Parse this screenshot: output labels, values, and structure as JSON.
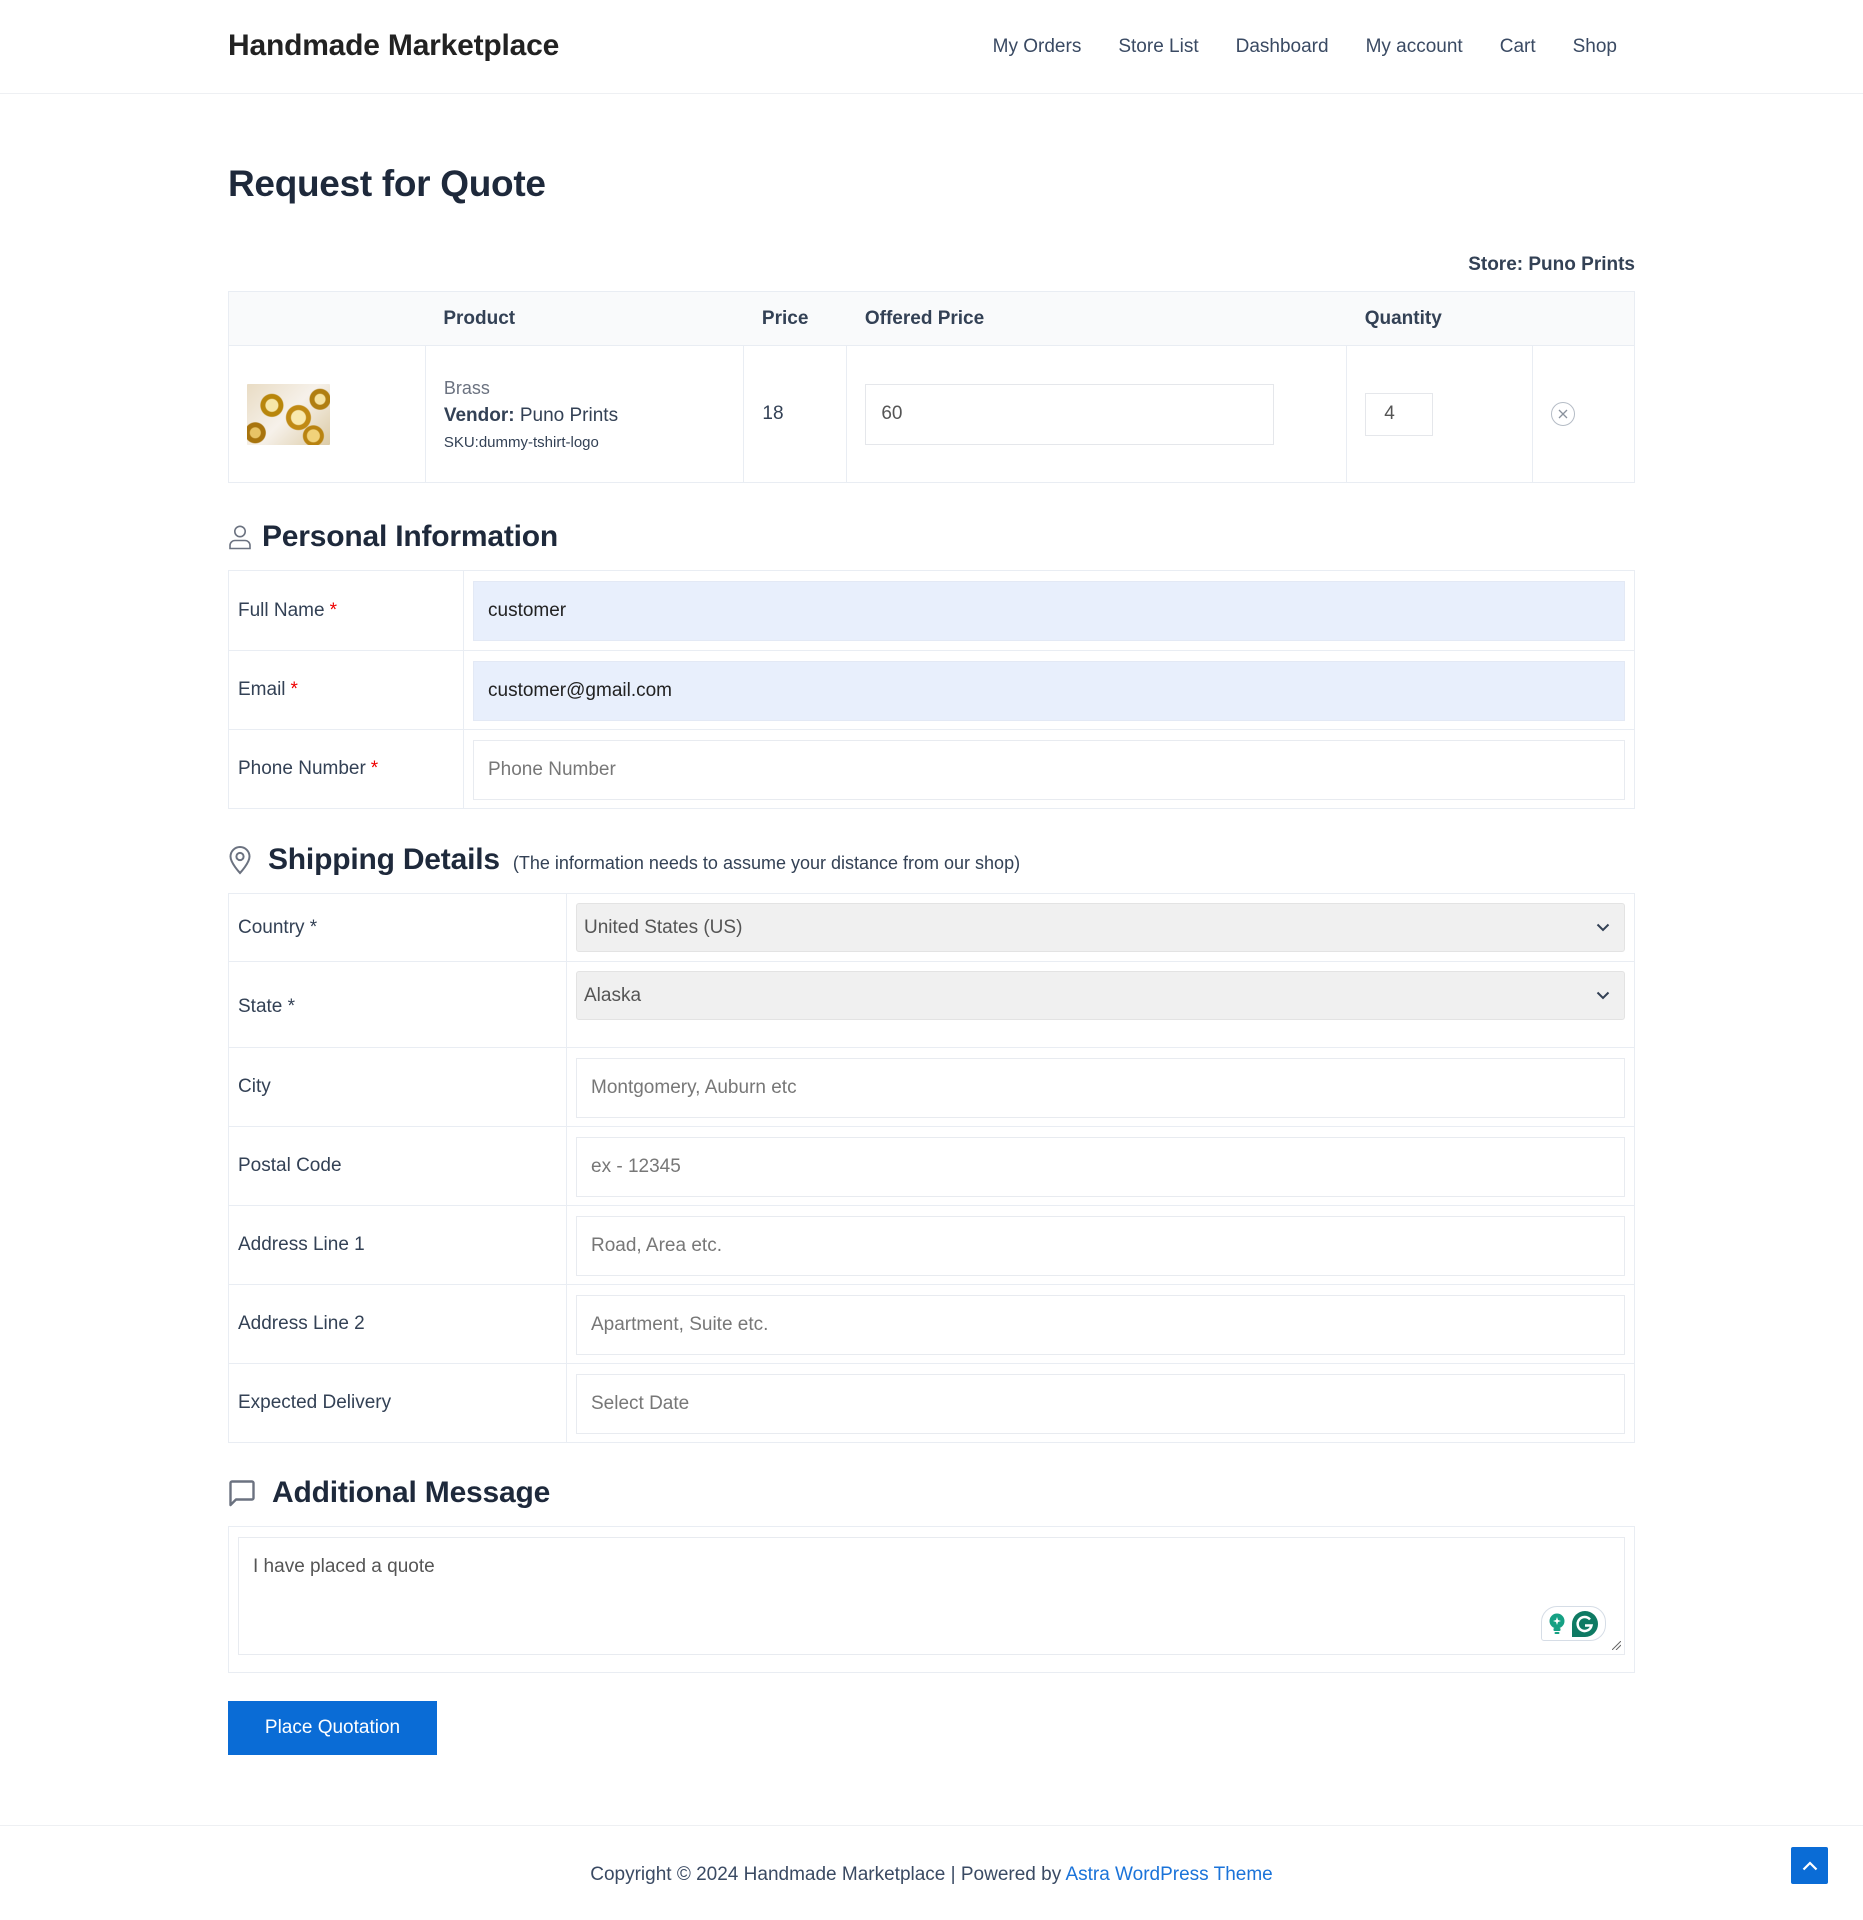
{
  "site": {
    "title": "Handmade Marketplace",
    "nav": [
      "My Orders",
      "Store List",
      "Dashboard",
      "My account",
      "Cart",
      "Shop"
    ]
  },
  "page": {
    "title": "Request for Quote",
    "store_label": "Store: Puno Prints"
  },
  "cart_table": {
    "headers": [
      "",
      "Product",
      "Price",
      "Offered Price",
      "Quantity",
      ""
    ],
    "rows": [
      {
        "image_alt": "brass-fittings-thumbnail",
        "product_name": "Brass",
        "vendor_label": "Vendor:",
        "vendor_name": "Puno Prints",
        "sku": "SKU:dummy-tshirt-logo",
        "price": "18",
        "offered_price": "60",
        "quantity": "4",
        "remove_icon": "close-circle-icon"
      }
    ]
  },
  "personal_info": {
    "heading": "Personal Information",
    "icon": "user-icon",
    "fields": [
      {
        "label": "Full Name",
        "required": "*",
        "value": "customer",
        "placeholder": ""
      },
      {
        "label": "Email",
        "required": "*",
        "value": "customer@gmail.com",
        "placeholder": ""
      },
      {
        "label": "Phone Number",
        "required": "*",
        "value": "",
        "placeholder": "Phone Number"
      }
    ]
  },
  "shipping": {
    "heading": "Shipping Details",
    "subheading": "(The information needs to assume your distance from our shop)",
    "icon": "map-pin-icon",
    "country": {
      "label": "Country *",
      "selected": "United States (US)"
    },
    "state": {
      "label": "State *",
      "selected": "Alaska"
    },
    "fields": [
      {
        "label": "City",
        "placeholder": "Montgomery, Auburn etc"
      },
      {
        "label": "Postal Code",
        "placeholder": "ex - 12345"
      },
      {
        "label": "Address Line 1",
        "placeholder": "Road, Area etc."
      },
      {
        "label": "Address Line 2",
        "placeholder": "Apartment, Suite etc."
      },
      {
        "label": "Expected Delivery",
        "placeholder": "Select Date"
      }
    ]
  },
  "additional": {
    "heading": "Additional Message",
    "icon": "chat-bubble-icon",
    "message": "I have placed a quote"
  },
  "actions": {
    "place_quotation": "Place Quotation"
  },
  "footer": {
    "copyright_prefix": "Copyright © 2024 Handmade Marketplace | Powered by ",
    "theme_link": "Astra WordPress Theme"
  },
  "colors": {
    "accent": "#0a6cd6",
    "autofill_bg": "#e8effc",
    "required": "#ee0000",
    "grammarly": "#15a083"
  }
}
